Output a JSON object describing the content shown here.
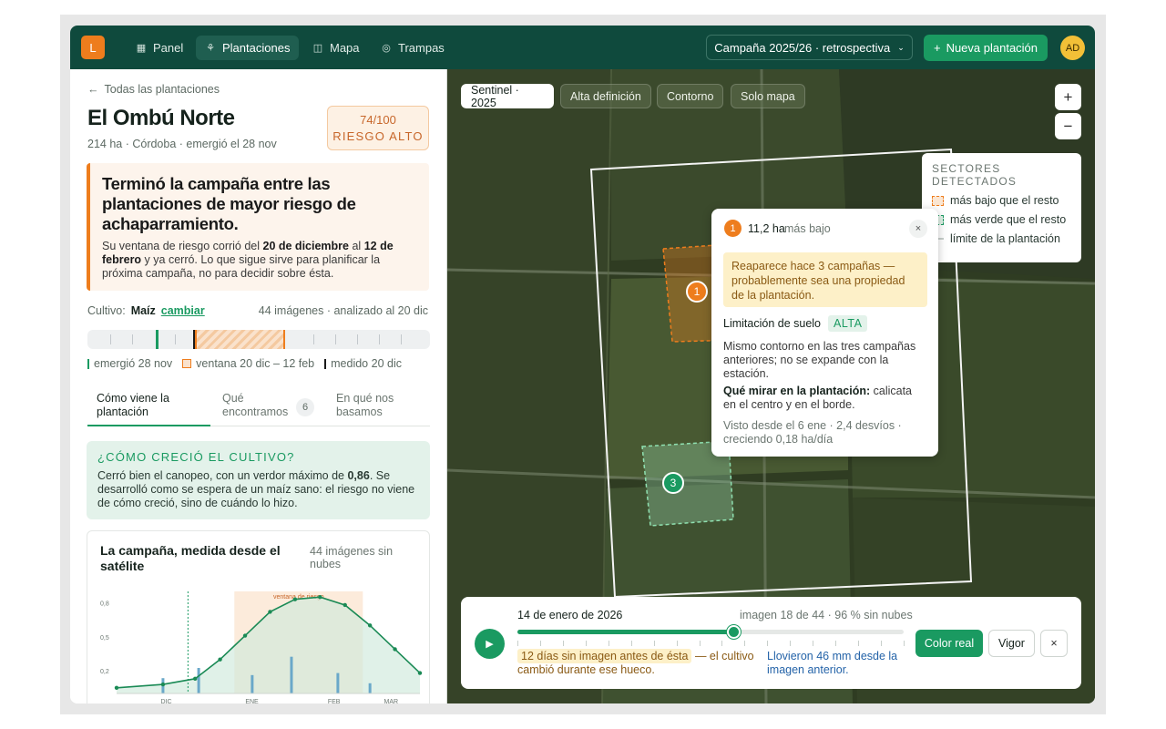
{
  "nav": {
    "logo": "L",
    "items": [
      {
        "label": "Panel",
        "icon": "grid-icon",
        "active": false
      },
      {
        "label": "Plantaciones",
        "icon": "sprout-icon",
        "active": true
      },
      {
        "label": "Mapa",
        "icon": "map-icon",
        "active": false
      },
      {
        "label": "Trampas",
        "icon": "target-icon",
        "active": false
      }
    ],
    "campaign": "Campaña 2025/26 · retrospectiva",
    "new_button": "Nueva plantación",
    "avatar": "AD"
  },
  "left": {
    "back": "Todas las plantaciones",
    "title": "El Ombú Norte",
    "subtitle": "214 ha · Córdoba · emergió el 28 nov",
    "risk": {
      "score": "74/100",
      "level": "RIESGO ALTO"
    },
    "alert": {
      "heading": "Terminó la campaña entre las plantaciones de mayor riesgo de achaparramiento.",
      "p_pre": "Su ventana de riesgo corrió del ",
      "p_b1": "20 de diciembre",
      "p_mid": " al ",
      "p_b2": "12 de febrero",
      "p_post": " y ya cerró. Lo que sigue sirve para planificar la próxima campaña, no para decidir sobre ésta."
    },
    "crop": {
      "label": "Cultivo:",
      "value": "Maíz",
      "change": "cambiar",
      "meta": "44 imágenes · analizado al 20 dic"
    },
    "legend": {
      "emerged": "emergió 28 nov",
      "window": "ventana 20 dic – 12 feb",
      "measured": "medido 20 dic"
    },
    "tabs": [
      {
        "label": "Cómo viene la plantación",
        "active": true
      },
      {
        "label": "Qué encontramos",
        "active": false,
        "badge": "6"
      },
      {
        "label": "En qué nos basamos",
        "active": false
      }
    ],
    "grow": {
      "heading": "¿CÓMO CRECIÓ EL CULTIVO?",
      "p_pre": "Cerró bien el canopeo, con un verdor máximo de ",
      "p_b": "0,86",
      "p_post": ". Se desarrolló como se espera de un maíz sano: el riesgo no viene de cómo creció, sino de cuándo lo hizo."
    },
    "chart_card": {
      "title": "La campaña, medida desde el satélite",
      "note": "44 imágenes sin nubes"
    }
  },
  "chart_data": {
    "type": "line",
    "title": "La campaña, medida desde el satélite",
    "x_labels": [
      "DIC",
      "ENE",
      "FEB",
      "MAR"
    ],
    "y_ticks": [
      "0,8",
      "0,5",
      "0,2"
    ],
    "ylim": [
      0,
      0.9
    ],
    "annotation": "ventana de riesgo",
    "series": [
      {
        "x": [
          0,
          0.65,
          1.1,
          1.45,
          1.8,
          2.15,
          2.5,
          2.85,
          3.2,
          3.55,
          3.9,
          4.25
        ],
        "values": [
          0.05,
          0.08,
          0.13,
          0.3,
          0.51,
          0.72,
          0.83,
          0.85,
          0.78,
          0.6,
          0.39,
          0.18
        ]
      }
    ],
    "rain_x": [
      0.65,
      1.15,
      1.9,
      2.45,
      3.1,
      3.55
    ],
    "rain_values": [
      0.15,
      0.25,
      0.18,
      0.36,
      0.2,
      0.1
    ],
    "window_range": [
      1.65,
      3.45
    ],
    "emergence_x": 1.0,
    "grid": false
  },
  "map": {
    "layers": [
      {
        "label": "Sentinel · 2025",
        "active": true
      },
      {
        "label": "Alta definición",
        "active": false
      },
      {
        "label": "Contorno",
        "active": false
      },
      {
        "label": "Solo mapa",
        "active": false
      }
    ],
    "zoom_in": "+",
    "zoom_out": "−",
    "sectors": {
      "heading": "SECTORES DETECTADOS",
      "items": [
        "más bajo que el resto",
        "más verde que el resto",
        "límite de la plantación"
      ]
    },
    "markers": [
      "1",
      "3"
    ],
    "popup": {
      "num": "1",
      "area": "11,2 ha",
      "tag": "más bajo",
      "close": "×",
      "warning": "Reaparece hace 3 campañas — probablemente sea una propiedad de la plantación.",
      "limit_label": "Limitación de suelo",
      "limit_value": "ALTA",
      "p1": "Mismo contorno en las tres campañas anteriores; no se expande con la estación.",
      "p2_b": "Qué mirar en la plantación:",
      "p2_post": " calicata en el centro y en el borde.",
      "p3": "Visto desde el 6 ene · 2,4 desvíos · creciendo 0,18 ha/día"
    },
    "timeline": {
      "date": "14 de enero de 2026",
      "meta": "imagen 18 de 44 · 96 % sin nubes",
      "progress": 0.56,
      "gap_hl": "12 días sin imagen antes de ésta",
      "gap_post": " — el cultivo cambió durante ese hueco.",
      "rain": "Llovieron 46 mm desde la imagen anterior.",
      "btn_real": "Color real",
      "btn_vigor": "Vigor",
      "btn_close": "×"
    }
  },
  "colors": {
    "brand": "#0f4a3d",
    "accent": "#1a9a61",
    "risk": "#ee7d1d"
  }
}
